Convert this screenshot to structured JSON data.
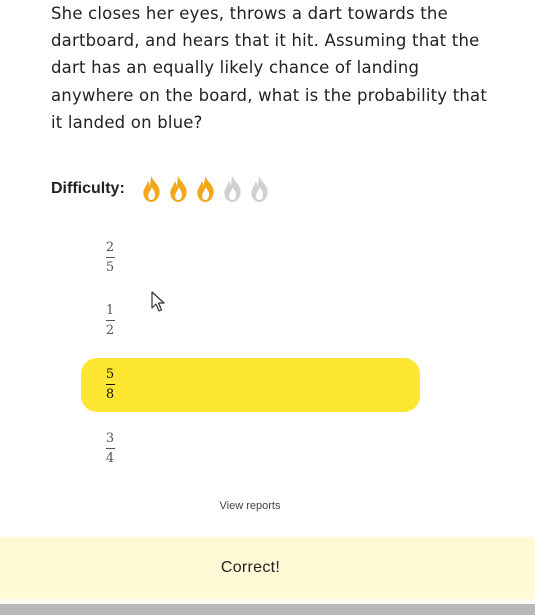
{
  "question": {
    "text": "She closes her eyes, throws a dart towards the dartboard, and hears that it hit. Assuming that the dart has an equally likely chance of landing anywhere on the board, what is the probability that it landed on blue?"
  },
  "difficulty": {
    "label": "Difficulty:",
    "level": 3,
    "max": 5,
    "icon": "flame-icon",
    "active_color": "#f2a81d",
    "inactive_color": "#d0d0d0"
  },
  "options": [
    {
      "numerator": "2",
      "denominator": "5",
      "selected": false
    },
    {
      "numerator": "1",
      "denominator": "2",
      "selected": false
    },
    {
      "numerator": "5",
      "denominator": "8",
      "selected": true
    },
    {
      "numerator": "3",
      "denominator": "4",
      "selected": false
    }
  ],
  "selected_color": "#fde631",
  "reports_link": "View reports",
  "feedback": {
    "text": "Correct!",
    "background": "#fff9d6"
  }
}
